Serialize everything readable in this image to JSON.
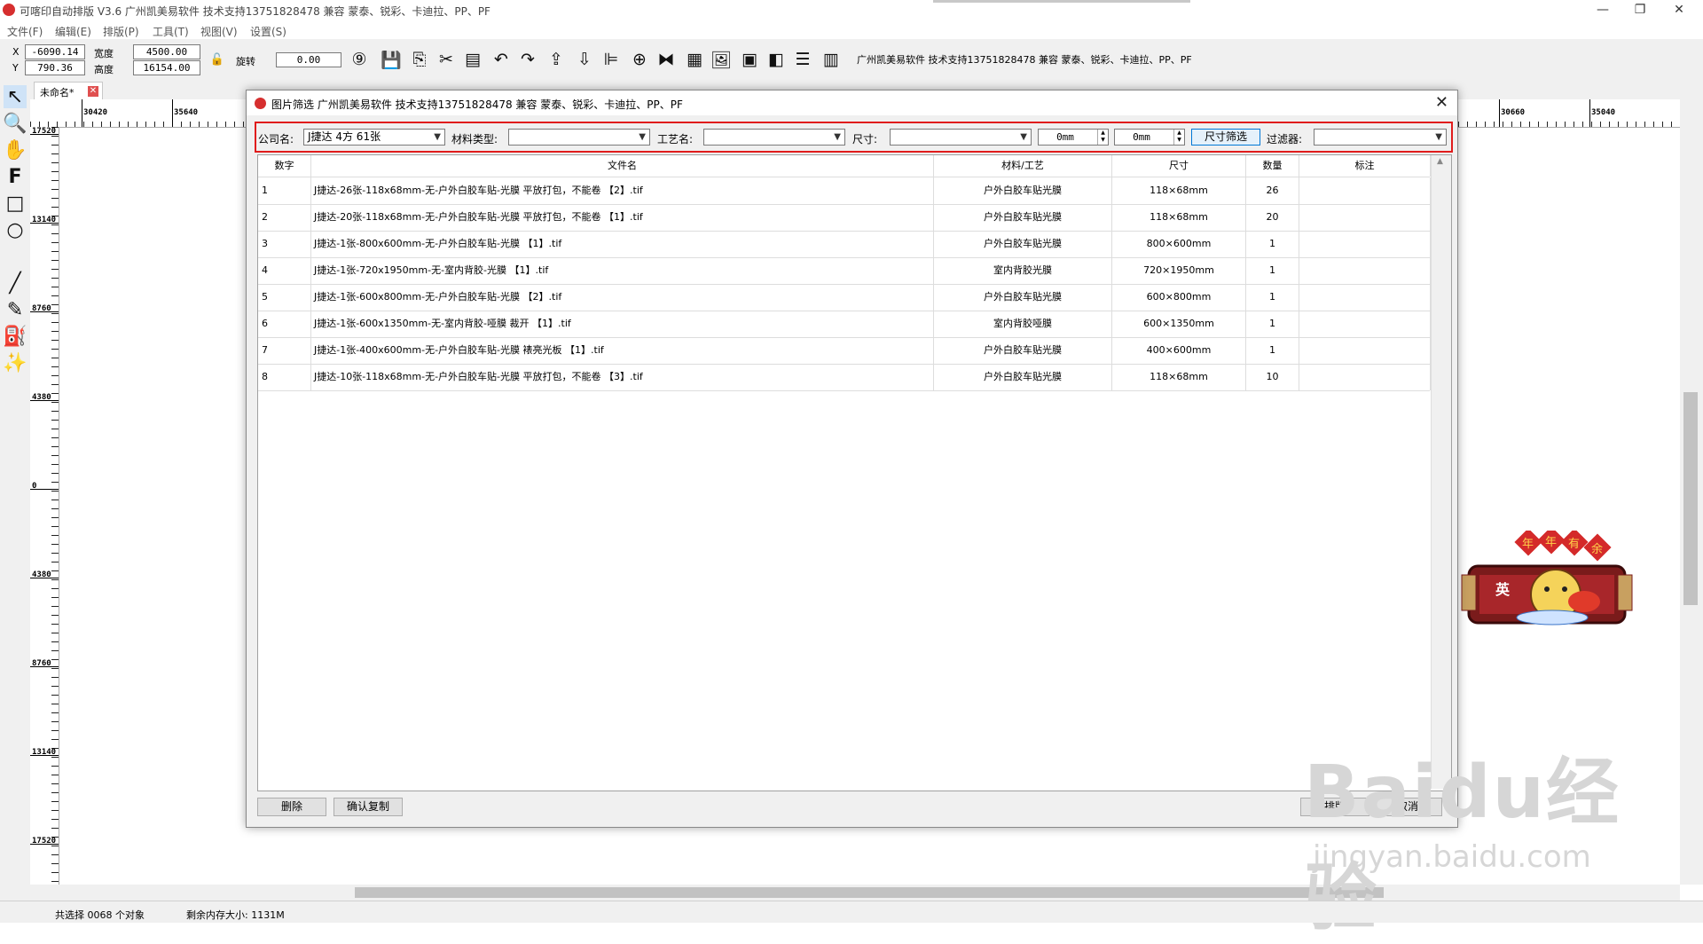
{
  "window": {
    "title": "可喀印自动排版 V3.6 广州凯美易软件 技术支持13751828478 兼容 蒙泰、锐彩、卡迪拉、PP、PF",
    "minimize": "—",
    "restore": "❐",
    "close": "✕"
  },
  "menu": [
    "文件(F)",
    "编辑(E)",
    "排版(P)",
    "工具(T)",
    "视图(V)",
    "设置(S)"
  ],
  "toolbar": {
    "x_label": "X",
    "y_label": "Y",
    "x_value": "-6090.14",
    "y_value": "790.36",
    "width_label": "宽度",
    "height_label": "高度",
    "width_value": "4500.00",
    "height_value": "16154.00",
    "rotate_label": "旋转",
    "rotate_value": "0.00",
    "support_text": "广州凯美易软件 技术支持13751828478 兼容 蒙泰、锐彩、卡迪拉、PP、PF"
  },
  "document_tab": {
    "label": "未命名*",
    "close": "✕"
  },
  "rulers": {
    "horizontal": [
      "30420",
      "35640",
      "30660",
      "35040"
    ],
    "vertical": [
      "17520",
      "13140",
      "8760",
      "4380",
      "0",
      "4380",
      "8760",
      "13140",
      "17520"
    ]
  },
  "dialog": {
    "title": "图片筛选 广州凯美易软件 技术支持13751828478 兼容 蒙泰、锐彩、卡迪拉、PP、PF",
    "close": "✕",
    "filters": {
      "company_label": "公司名:",
      "company_value": "J捷达 4方 61张",
      "material_label": "材料类型:",
      "material_value": "",
      "process_label": "工艺名:",
      "process_value": "",
      "size_label": "尺寸:",
      "size_value": "",
      "size_w": "0mm",
      "size_h": "0mm",
      "size_filter_button": "尺寸筛选",
      "filter_label": "过滤器:",
      "filter_value": ""
    },
    "columns": [
      "数字",
      "文件名",
      "材料/工艺",
      "尺寸",
      "数量",
      "标注"
    ],
    "rows": [
      {
        "num": "1",
        "file": "J捷达-26张-118x68mm-无-户外白胶车贴-光膜 平放打包，不能卷 【2】.tif",
        "material": "户外白胶车贴光膜",
        "size": "118×68mm",
        "qty": "26",
        "note": ""
      },
      {
        "num": "2",
        "file": "J捷达-20张-118x68mm-无-户外白胶车贴-光膜 平放打包，不能卷 【1】.tif",
        "material": "户外白胶车贴光膜",
        "size": "118×68mm",
        "qty": "20",
        "note": ""
      },
      {
        "num": "3",
        "file": "J捷达-1张-800x600mm-无-户外白胶车贴-光膜 【1】.tif",
        "material": "户外白胶车贴光膜",
        "size": "800×600mm",
        "qty": "1",
        "note": ""
      },
      {
        "num": "4",
        "file": "J捷达-1张-720x1950mm-无-室内背胶-光膜 【1】.tif",
        "material": "室内背胶光膜",
        "size": "720×1950mm",
        "qty": "1",
        "note": ""
      },
      {
        "num": "5",
        "file": "J捷达-1张-600x800mm-无-户外白胶车贴-光膜 【2】.tif",
        "material": "户外白胶车贴光膜",
        "size": "600×800mm",
        "qty": "1",
        "note": ""
      },
      {
        "num": "6",
        "file": "J捷达-1张-600x1350mm-无-室内背胶-哑膜 裁开 【1】.tif",
        "material": "室内背胶哑膜",
        "size": "600×1350mm",
        "qty": "1",
        "note": ""
      },
      {
        "num": "7",
        "file": "J捷达-1张-400x600mm-无-户外白胶车贴-光膜 裱亮光板 【1】.tif",
        "material": "户外白胶车贴光膜",
        "size": "400×600mm",
        "qty": "1",
        "note": ""
      },
      {
        "num": "8",
        "file": "J捷达-10张-118x68mm-无-户外白胶车贴-光膜 平放打包，不能卷 【3】.tif",
        "material": "户外白胶车贴光膜",
        "size": "118×68mm",
        "qty": "10",
        "note": ""
      }
    ],
    "buttons": {
      "delete": "删除",
      "confirm_copy": "确认复制",
      "layout": "排版",
      "cancel": "取消"
    }
  },
  "decoration": {
    "banner_chars": [
      "年",
      "年",
      "有",
      "余"
    ],
    "side_char": "英"
  },
  "watermark": {
    "brand": "Baidu经验",
    "url": "jingyan.baidu.com"
  },
  "status": {
    "selection": "共选择 0068 个对象",
    "memory": "剩余内存大小: 1131M"
  },
  "colors": {
    "highlight_border": "#e01c1c",
    "accent": "#0078d7"
  }
}
